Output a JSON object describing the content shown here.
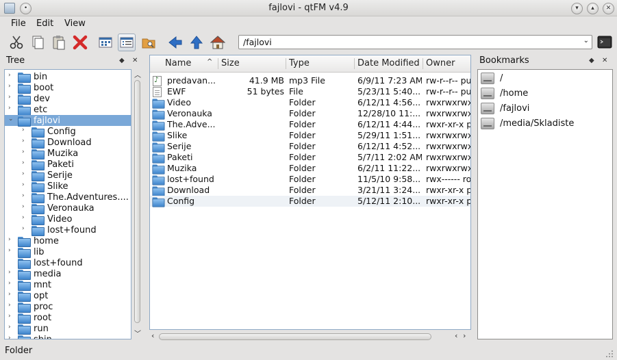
{
  "window": {
    "title": "fajlovi - qtFM v4.9"
  },
  "menu": [
    "File",
    "Edit",
    "View"
  ],
  "toolbar": {
    "icons": [
      "cut-icon",
      "copy-icon",
      "paste-icon",
      "delete-icon",
      "icon-view-icon",
      "detail-view-icon",
      "folder-search-icon",
      "back-icon",
      "up-icon",
      "home-icon"
    ],
    "accent_delete": "#d42a2a",
    "accent_nav": "#2f6fc4"
  },
  "path": {
    "value": "/fajlovi"
  },
  "tree": {
    "title": "Tree",
    "items": [
      {
        "label": "bin",
        "level": 0,
        "expander": "›"
      },
      {
        "label": "boot",
        "level": 0,
        "expander": "›"
      },
      {
        "label": "dev",
        "level": 0,
        "expander": "›"
      },
      {
        "label": "etc",
        "level": 0,
        "expander": "›"
      },
      {
        "label": "fajlovi",
        "level": 0,
        "expander": "⌄",
        "selected": true
      },
      {
        "label": "Config",
        "level": 1,
        "expander": "›"
      },
      {
        "label": "Download",
        "level": 1,
        "expander": "›"
      },
      {
        "label": "Muzika",
        "level": 1,
        "expander": "›"
      },
      {
        "label": "Paketi",
        "level": 1,
        "expander": "›"
      },
      {
        "label": "Serije",
        "level": 1,
        "expander": "›"
      },
      {
        "label": "Slike",
        "level": 1,
        "expander": "›"
      },
      {
        "label": "The.Adventures....",
        "level": 1,
        "expander": "›"
      },
      {
        "label": "Veronauka",
        "level": 1,
        "expander": "›"
      },
      {
        "label": "Video",
        "level": 1,
        "expander": "›"
      },
      {
        "label": "lost+found",
        "level": 1,
        "expander": "›"
      },
      {
        "label": "home",
        "level": 0,
        "expander": "›"
      },
      {
        "label": "lib",
        "level": 0,
        "expander": "›"
      },
      {
        "label": "lost+found",
        "level": 0,
        "expander": ""
      },
      {
        "label": "media",
        "level": 0,
        "expander": "›"
      },
      {
        "label": "mnt",
        "level": 0,
        "expander": "›"
      },
      {
        "label": "opt",
        "level": 0,
        "expander": "›"
      },
      {
        "label": "proc",
        "level": 0,
        "expander": "›"
      },
      {
        "label": "root",
        "level": 0,
        "expander": "›"
      },
      {
        "label": "run",
        "level": 0,
        "expander": "›"
      },
      {
        "label": "sbin",
        "level": 0,
        "expander": "›"
      }
    ]
  },
  "files": {
    "columns": [
      "Name",
      "Size",
      "Type",
      "Date Modified",
      "Owner"
    ],
    "sort_indicator": "^",
    "rows": [
      {
        "name": "predavan...",
        "size": "41.9 MB",
        "type": "mp3 File",
        "date": "6/9/11 7:23 AM",
        "owner": "rw-r--r-- pur",
        "icon": "music"
      },
      {
        "name": "EWF",
        "size": "51 bytes",
        "type": "File",
        "date": "5/23/11 5:40...",
        "owner": "rw-r--r-- pur",
        "icon": "doc"
      },
      {
        "name": "Video",
        "size": "",
        "type": "Folder",
        "date": "6/12/11 4:56...",
        "owner": "rwxrwxrwx",
        "icon": "folder"
      },
      {
        "name": "Veronauka",
        "size": "",
        "type": "Folder",
        "date": "12/28/10 11:...",
        "owner": "rwxrwxrwx",
        "icon": "folder"
      },
      {
        "name": "The.Adve...",
        "size": "",
        "type": "Folder",
        "date": "6/12/11 4:44...",
        "owner": "rwxr-xr-x pu",
        "icon": "folder"
      },
      {
        "name": "Slike",
        "size": "",
        "type": "Folder",
        "date": "5/29/11 1:51...",
        "owner": "rwxrwxrwx",
        "icon": "folder"
      },
      {
        "name": "Serije",
        "size": "",
        "type": "Folder",
        "date": "6/12/11 4:52...",
        "owner": "rwxrwxrwx",
        "icon": "folder"
      },
      {
        "name": "Paketi",
        "size": "",
        "type": "Folder",
        "date": "5/7/11 2:02 AM",
        "owner": "rwxrwxrwx",
        "icon": "folder"
      },
      {
        "name": "Muzika",
        "size": "",
        "type": "Folder",
        "date": "6/2/11 11:22...",
        "owner": "rwxrwxrwx",
        "icon": "folder"
      },
      {
        "name": "lost+found",
        "size": "",
        "type": "Folder",
        "date": "11/5/10 9:58...",
        "owner": "rwx------ roo",
        "icon": "folder"
      },
      {
        "name": "Download",
        "size": "",
        "type": "Folder",
        "date": "3/21/11 3:24...",
        "owner": "rwxr-xr-x pu",
        "icon": "folder"
      },
      {
        "name": "Config",
        "size": "",
        "type": "Folder",
        "date": "5/12/11 2:10...",
        "owner": "rwxr-xr-x pu",
        "icon": "folder",
        "highlighted": true
      }
    ]
  },
  "bookmarks": {
    "title": "Bookmarks",
    "items": [
      "/",
      "/home",
      "/fajlovi",
      "/media/Skladiste"
    ]
  },
  "status": {
    "text": "Folder"
  },
  "colors": {
    "selection": "#7aa8d8",
    "folder": "#4d8fd0",
    "panel_border": "#8ea8c4"
  }
}
